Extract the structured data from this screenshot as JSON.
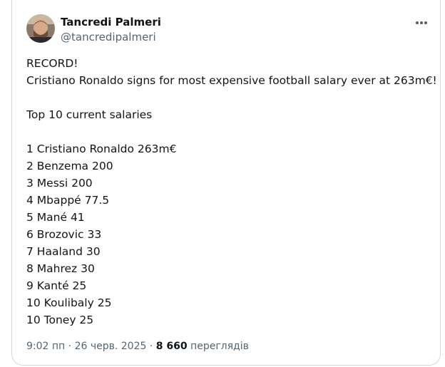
{
  "author": {
    "name": "Tancredi Palmeri",
    "handle": "@tancredipalmeri"
  },
  "icons": {
    "more": "more-horizontal-icon",
    "avatar": "profile-photo"
  },
  "tweet": {
    "lines": [
      "RECORD!",
      "Cristiano Ronaldo signs for most expensive football salary ever at 263m€!",
      "",
      "Top 10 current salaries",
      "",
      "1 Cristiano Ronaldo 263m€",
      "2 Benzema 200",
      "3 Messi 200",
      "4 Mbappé 77.5",
      "5 Mané 41",
      "6 Brozovic 33",
      "7 Haaland 30",
      "8 Mahrez 30",
      "9 Kanté 25",
      "10 Koulibaly 25",
      "10 Toney 25"
    ]
  },
  "meta": {
    "time": "9:02 пп",
    "separator": "·",
    "date": "26 черв. 2025",
    "views_count": "8 660",
    "views_label": "переглядів"
  }
}
